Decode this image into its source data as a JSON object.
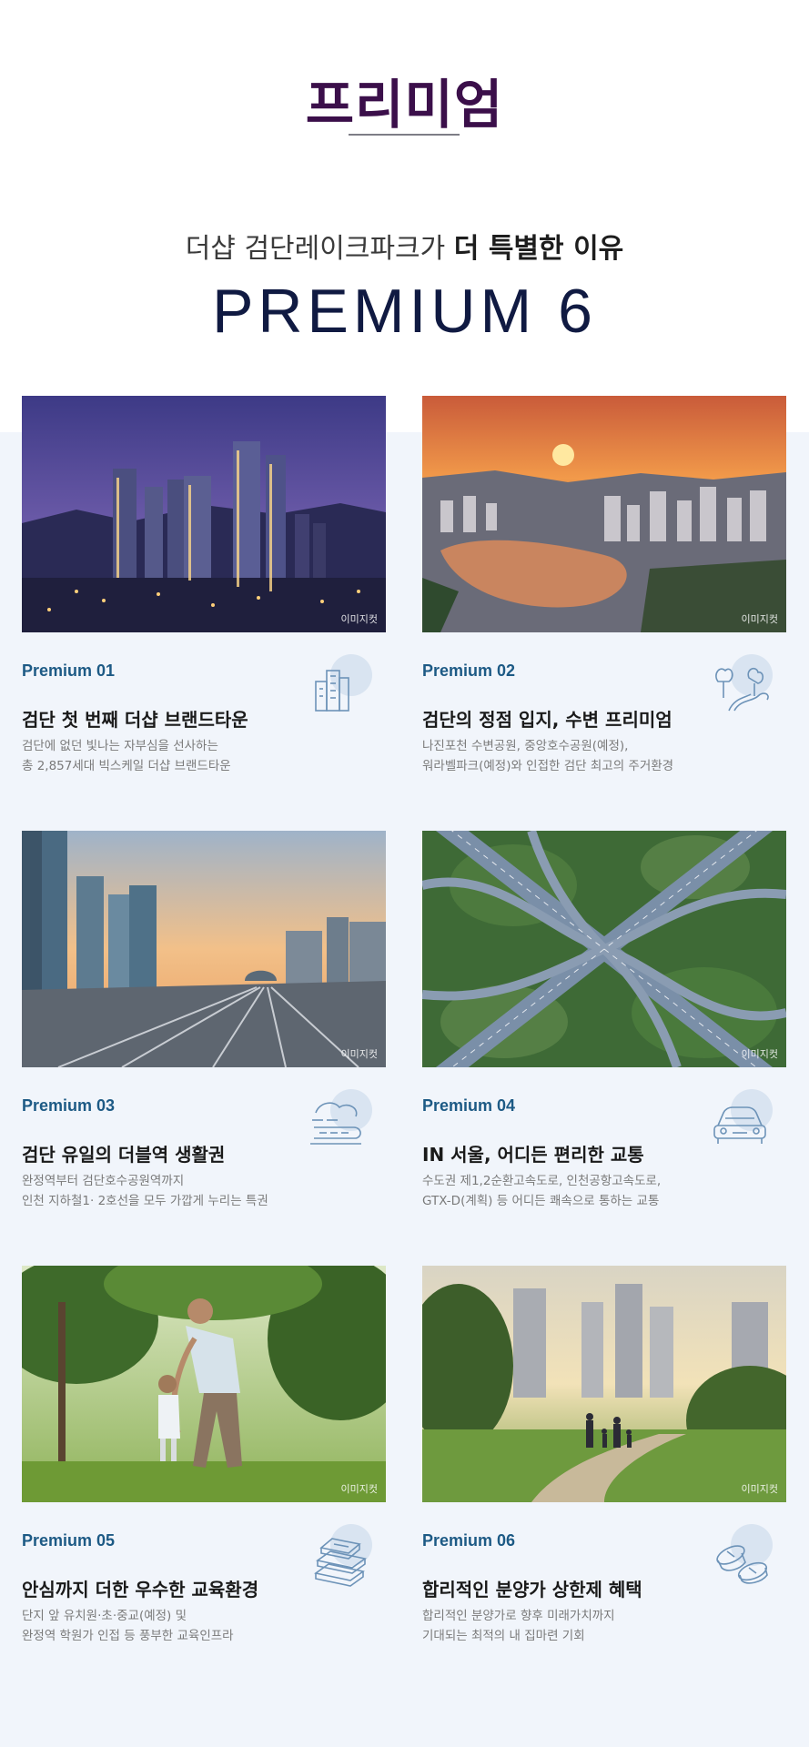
{
  "header": {
    "title": "프리미엄",
    "subtitle_normal": "더샵 검단레이크파크가 ",
    "subtitle_bold": "더 특별한 이유",
    "premium_heading": "PREMIUM 6"
  },
  "colors": {
    "title": "#3b0f4a",
    "heading": "#101a42",
    "accent_number": "#1d5a85",
    "background": "#f1f5fb",
    "icon_blob": "#d9e4f1",
    "icon_stroke": "#6d93b8"
  },
  "watermark_text": "이미지컷",
  "cards": [
    {
      "number": "Premium 01",
      "title": "검단 첫 번째 더샵 브랜드타운",
      "desc_line1": "검단에 없던 빛나는 자부심을 선사하는",
      "desc_line2": "총 2,857세대 빅스케일 더샵 브랜드타운",
      "icon": "buildings-icon",
      "image": "night-city-skyline-image"
    },
    {
      "number": "Premium 02",
      "title": "검단의 정점 입지, 수변 프리미엄",
      "desc_line1": "나진포천 수변공원, 중앙호수공원(예정),",
      "desc_line2": "워라벨파크(예정)와 인접한 검단 최고의 주거환경",
      "icon": "park-trees-icon",
      "image": "sunset-lake-city-image"
    },
    {
      "number": "Premium 03",
      "title": "검단 유일의 더블역 생활권",
      "desc_line1": "완정역부터 검단호수공원역까지",
      "desc_line2": "인천 지하철1· 2호선을 모두 가깝게 누리는 특권",
      "icon": "subway-train-icon",
      "image": "railway-station-image"
    },
    {
      "number": "Premium 04",
      "title": "IN 서울, 어디든 편리한 교통",
      "desc_line1": "수도권 제1,2순환고속도로, 인천공항고속도로,",
      "desc_line2": "GTX-D(계획) 등 어디든 쾌속으로 통하는 교통",
      "icon": "car-icon",
      "image": "highway-interchange-image"
    },
    {
      "number": "Premium 05",
      "title": "안심까지 더한 우수한 교육환경",
      "desc_line1": "단지 앞 유치원·초·중교(예정) 및",
      "desc_line2": "완정역 학원가 인접 등 풍부한 교육인프라",
      "icon": "books-icon",
      "image": "father-child-park-image"
    },
    {
      "number": "Premium 06",
      "title": "합리적인 분양가 상한제 혜택",
      "desc_line1": "합리적인 분양가로 향후 미래가치까지",
      "desc_line2": "기대되는 최적의 내 집마련 기회",
      "icon": "coins-icon",
      "image": "family-park-apartments-image"
    }
  ]
}
